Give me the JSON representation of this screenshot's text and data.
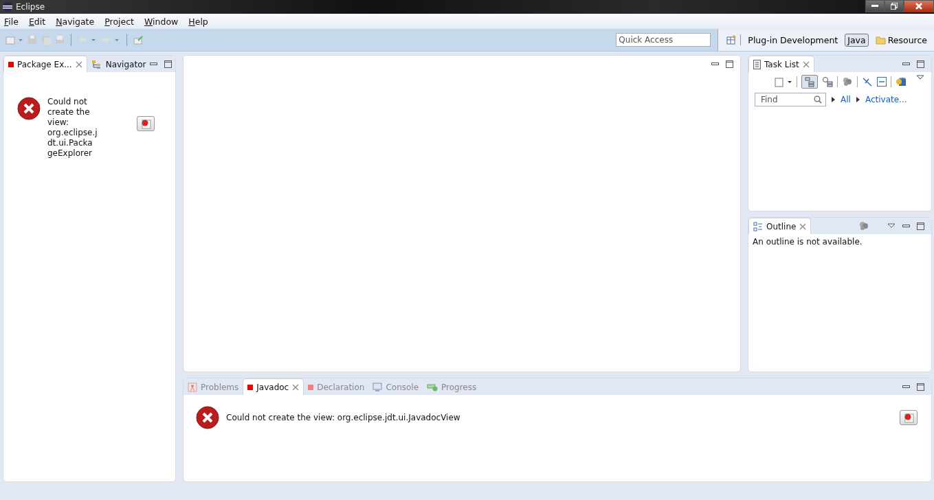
{
  "window": {
    "title": "Eclipse"
  },
  "menu": [
    "File",
    "Edit",
    "Navigate",
    "Project",
    "Window",
    "Help"
  ],
  "quick_access": {
    "placeholder": "Quick Access"
  },
  "perspectives": [
    {
      "label": "Plug-in Development",
      "selected": false
    },
    {
      "label": "Java",
      "selected": true
    },
    {
      "label": "Resource",
      "selected": false
    }
  ],
  "left_panel": {
    "tabs": [
      {
        "label": "Package Ex...",
        "selected": true
      },
      {
        "label": "Navigator",
        "selected": false
      }
    ],
    "error": [
      "Could not",
      "create the",
      "view:",
      "org.eclipse.j",
      "dt.ui.Packa",
      "geExplorer"
    ]
  },
  "task_list": {
    "tabs": [
      {
        "label": "Task List",
        "selected": true
      }
    ],
    "find": {
      "placeholder": "Find"
    },
    "links": [
      "All",
      "Activate..."
    ]
  },
  "outline": {
    "tabs": [
      {
        "label": "Outline",
        "selected": true
      }
    ],
    "message": "An outline is not available."
  },
  "bottom_panel": {
    "tabs": [
      {
        "label": "Problems",
        "selected": false
      },
      {
        "label": "Javadoc",
        "selected": true
      },
      {
        "label": "Declaration",
        "selected": false
      },
      {
        "label": "Console",
        "selected": false
      },
      {
        "label": "Progress",
        "selected": false
      }
    ],
    "error": "Could not create the view: org.eclipse.jdt.ui.JavadocView"
  }
}
